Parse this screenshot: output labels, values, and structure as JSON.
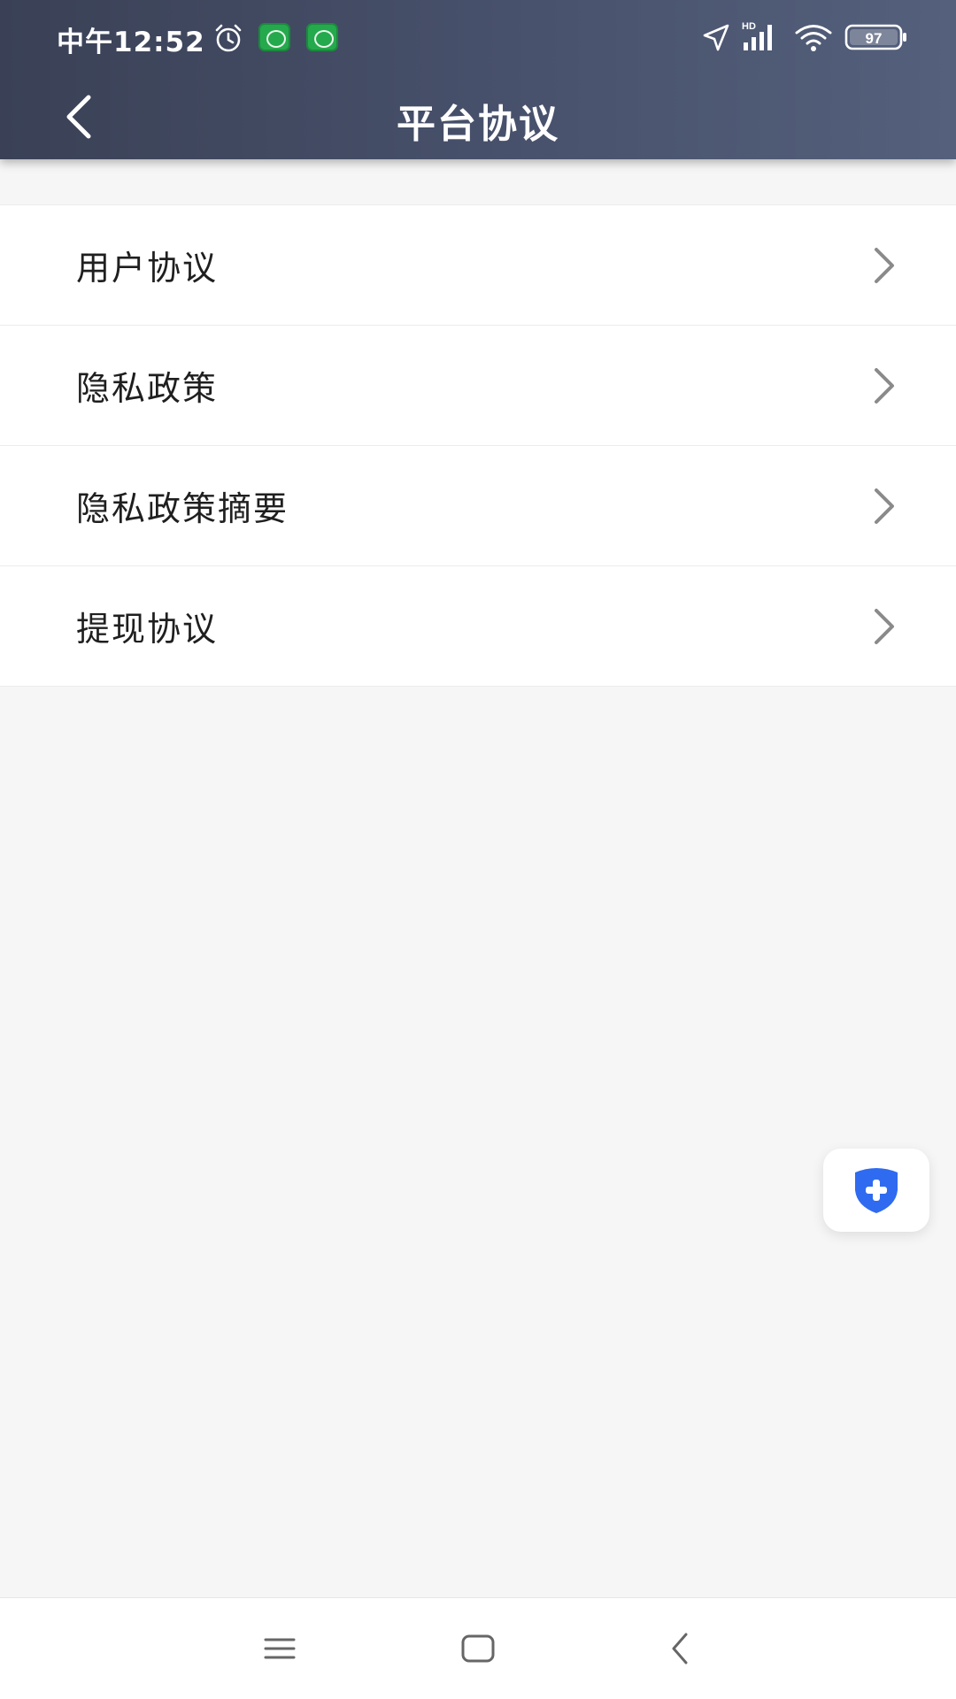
{
  "status_bar": {
    "time": "中午12:52",
    "battery": "97",
    "network": "HD",
    "icons": [
      "alarm-icon",
      "app-notification-icon",
      "app-notification-icon",
      "location-icon",
      "signal-icon",
      "wifi-icon",
      "battery-icon"
    ]
  },
  "header": {
    "title": "平台协议",
    "back_icon": "back-chevron-icon"
  },
  "menu": {
    "items": [
      {
        "label": "用户协议",
        "icon": "chevron-right-icon"
      },
      {
        "label": "隐私政策",
        "icon": "chevron-right-icon"
      },
      {
        "label": "隐私政策摘要",
        "icon": "chevron-right-icon"
      },
      {
        "label": "提现协议",
        "icon": "chevron-right-icon"
      }
    ]
  },
  "floating_button": {
    "icon": "shield-plus-icon",
    "color": "#2f6bf0"
  },
  "nav_bar": {
    "icons": [
      "menu-icon",
      "home-icon",
      "back-icon"
    ]
  },
  "colors": {
    "header_start": "#3a4156",
    "header_end": "#54607c",
    "page_background": "#f6f6f6",
    "text_primary": "#1f1f1f",
    "chevron": "#8a8a8a",
    "accent": "#2f6bf0"
  }
}
